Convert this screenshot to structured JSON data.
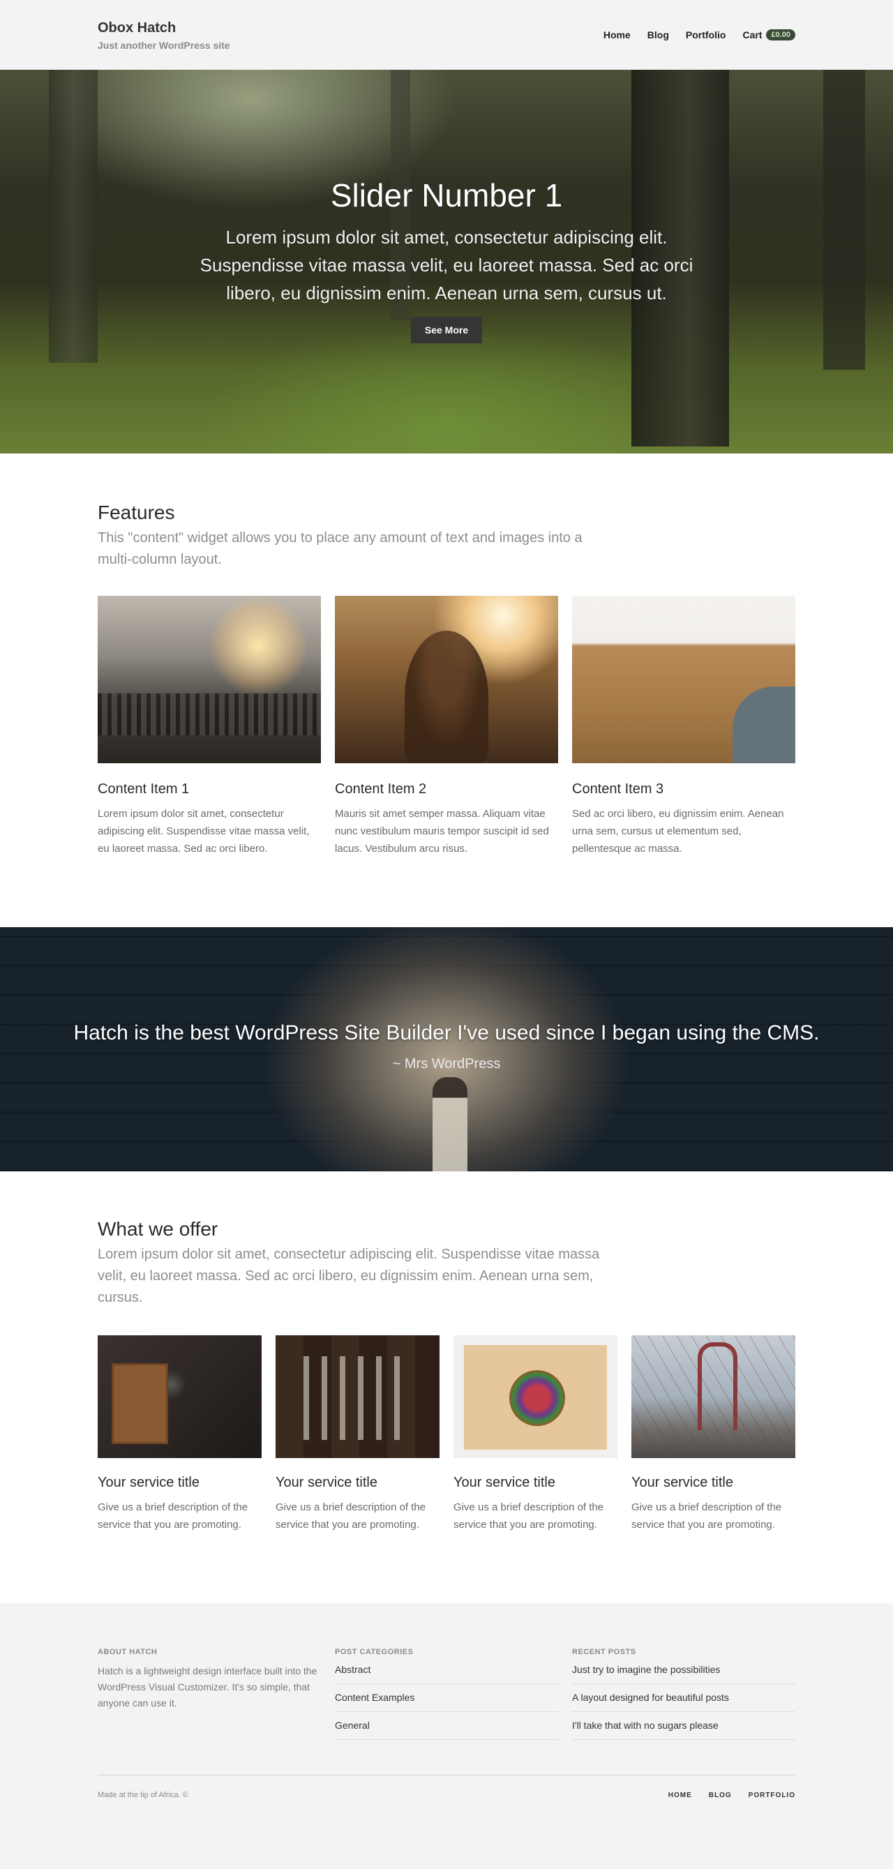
{
  "header": {
    "site_title": "Obox Hatch",
    "tagline": "Just another WordPress site",
    "nav": [
      "Home",
      "Blog",
      "Portfolio"
    ],
    "cart_label": "Cart",
    "cart_total": "£0.00"
  },
  "hero": {
    "title": "Slider Number 1",
    "text": "Lorem ipsum dolor sit amet, consectetur adipiscing elit. Suspendisse vitae massa velit, eu laoreet massa. Sed ac orci libero, eu dignissim enim. Aenean urna sem, cursus ut.",
    "button": "See More"
  },
  "features": {
    "title": "Features",
    "subtitle": "This \"content\" widget allows you to place any amount of text and images into a multi-column layout.",
    "items": [
      {
        "title": "Content Item 1",
        "text": "Lorem ipsum dolor sit amet, consectetur adipiscing elit. Suspendisse vitae massa velit, eu laoreet massa. Sed ac orci libero."
      },
      {
        "title": "Content Item 2",
        "text": "Mauris sit amet semper massa. Aliquam vitae nunc vestibulum mauris tempor suscipit id sed lacus. Vestibulum arcu risus."
      },
      {
        "title": "Content Item 3",
        "text": "Sed ac orci libero, eu dignissim enim. Aenean urna sem, cursus ut elementum sed, pellentesque ac massa."
      }
    ]
  },
  "testimonial": {
    "quote": "Hatch is the best WordPress Site Builder I've used since I began using the CMS.",
    "author": "~ Mrs WordPress"
  },
  "services": {
    "title": "What we offer",
    "subtitle": "Lorem ipsum dolor sit amet, consectetur adipiscing elit. Suspendisse vitae massa velit, eu laoreet massa. Sed ac orci libero, eu dignissim enim. Aenean urna sem, cursus.",
    "items": [
      {
        "title": "Your service title",
        "text": "Give us a brief description of the service that you are promoting."
      },
      {
        "title": "Your service title",
        "text": "Give us a brief description of the service that you are promoting."
      },
      {
        "title": "Your service title",
        "text": "Give us a brief description of the service that you are promoting."
      },
      {
        "title": "Your service title",
        "text": "Give us a brief description of the service that you are promoting."
      }
    ]
  },
  "footer": {
    "about_heading": "ABOUT HATCH",
    "about_text": "Hatch is a lightweight design interface built into the WordPress Visual Customizer. It's so simple, that anyone can use it.",
    "categories_heading": "POST CATEGORIES",
    "categories": [
      "Abstract",
      "Content Examples",
      "General"
    ],
    "recent_heading": "RECENT POSTS",
    "recent_posts": [
      "Just try to imagine the possibilities",
      "A layout designed for beautiful posts",
      "I'll take that with no sugars please"
    ],
    "copyright": "Made at the tip of Africa. ©",
    "nav": [
      "HOME",
      "BLOG",
      "PORTFOLIO"
    ]
  }
}
